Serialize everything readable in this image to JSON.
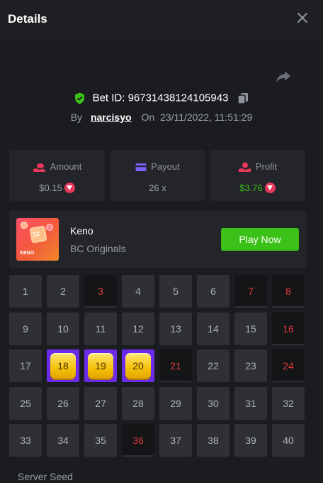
{
  "header": {
    "title": "Details"
  },
  "bet": {
    "id_label": "Bet ID: 96731438124105943",
    "by": "By",
    "user": "narcisyo",
    "on": "On",
    "date": "23/11/2022, 11:51:29"
  },
  "stats": [
    {
      "label": "Amount",
      "value": "$0.15",
      "icon": "money-hand-icon",
      "icon_color": "#e8385a",
      "value_color": "#9aa0a8"
    },
    {
      "label": "Payout",
      "value": "26 x",
      "icon": "wallet-card-icon",
      "icon_color": "#7b61ff",
      "value_color": "#9aa0a8"
    },
    {
      "label": "Profit",
      "value": "$3.76",
      "icon": "hand-coin-icon",
      "icon_color": "#e8385a",
      "value_color": "#3bc117"
    }
  ],
  "game": {
    "name": "Keno",
    "provider": "BC Originals",
    "play_label": "Play Now",
    "thumb_word": "KENO",
    "thumb_number": "12"
  },
  "grid": {
    "numbers": [
      "1",
      "2",
      "3",
      "4",
      "5",
      "6",
      "7",
      "8",
      "9",
      "10",
      "11",
      "12",
      "13",
      "14",
      "15",
      "16",
      "17",
      "18",
      "19",
      "20",
      "21",
      "22",
      "23",
      "24",
      "25",
      "26",
      "27",
      "28",
      "29",
      "30",
      "31",
      "32",
      "33",
      "34",
      "35",
      "36",
      "37",
      "38",
      "39",
      "40"
    ],
    "drawn": [
      3,
      7,
      8,
      16,
      21,
      24,
      36
    ],
    "hits": [
      18,
      19,
      20
    ]
  },
  "server_seed_label": "Server Seed",
  "colors": {
    "accent_green": "#3bc117",
    "miss_red": "#e23b3b",
    "hit_purple": "#6c2be8",
    "gem_yellow": "#f5c10b"
  }
}
